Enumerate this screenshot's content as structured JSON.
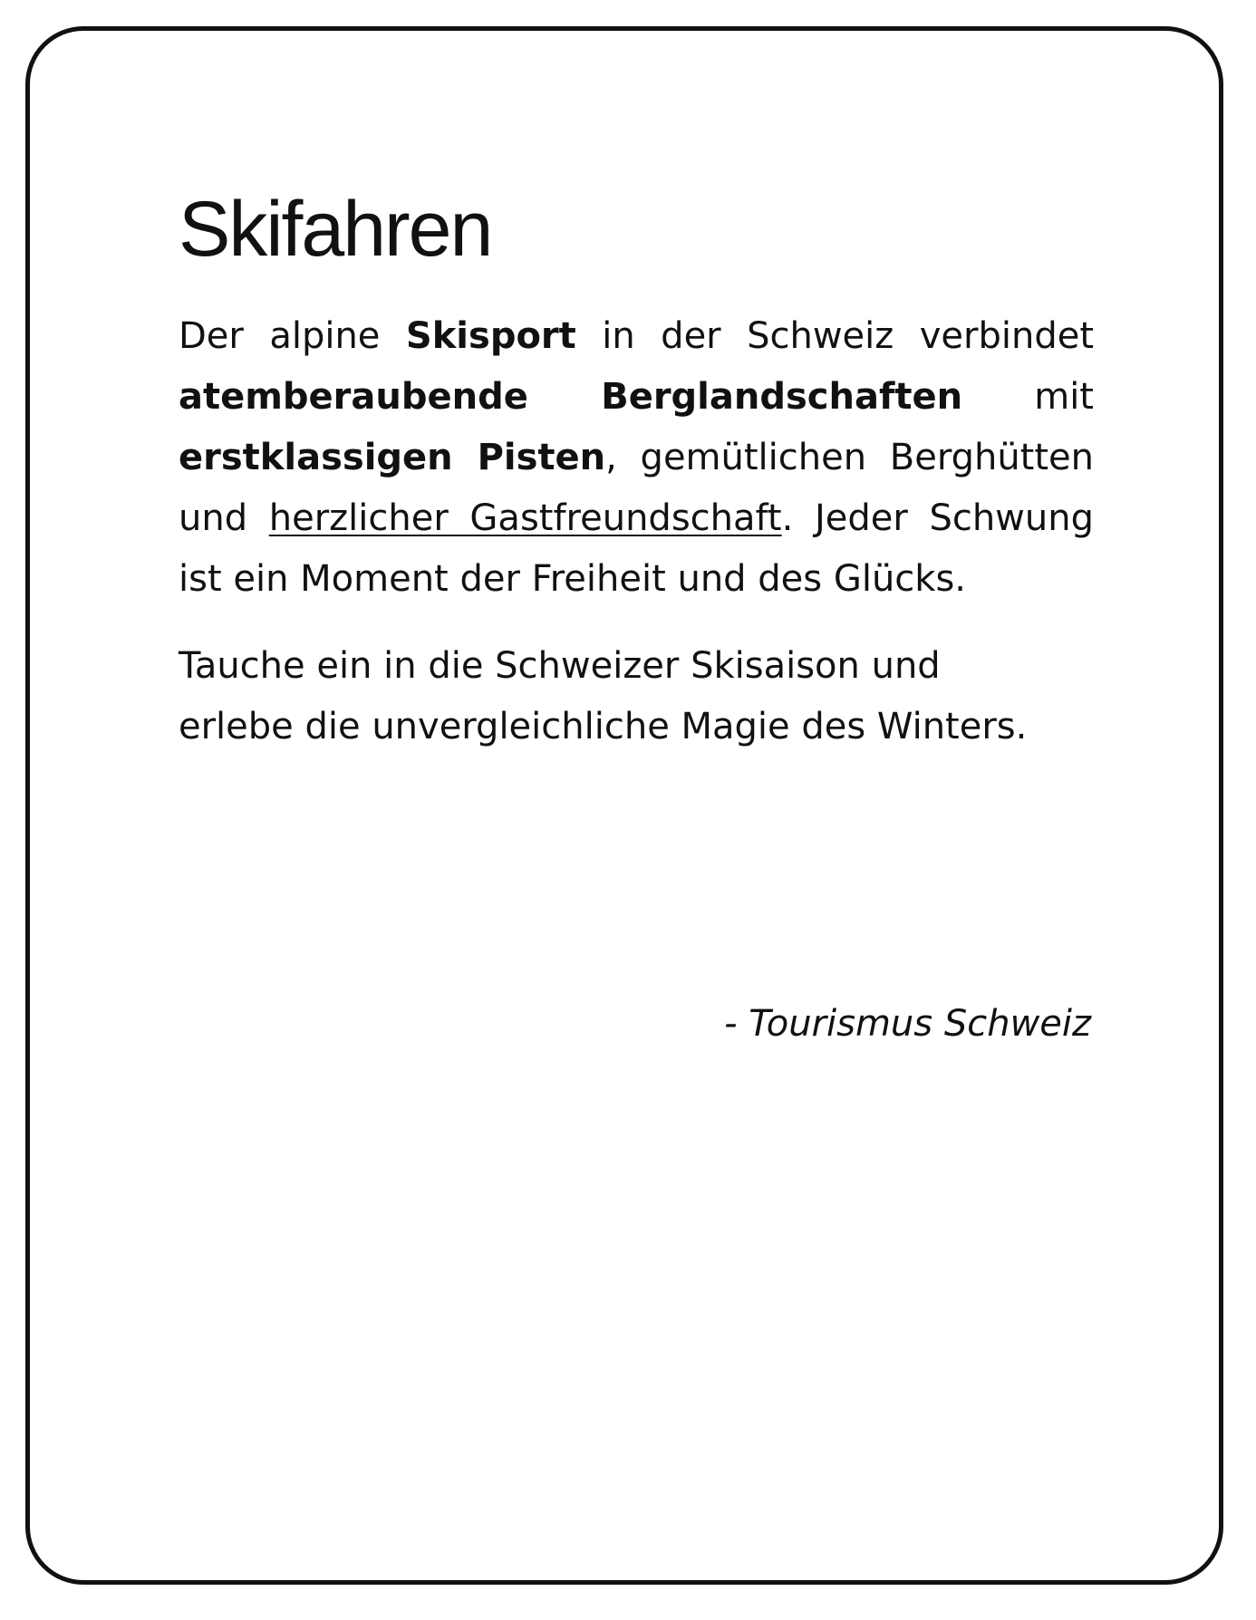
{
  "article": {
    "title": "Skifahren",
    "paragraph1": {
      "t1": "Der alpine ",
      "b1": "Skisport",
      "t2": " in der Schweiz verbindet ",
      "b2": "atemberaubende Berglandschaften",
      "t3": " mit ",
      "b3": "erstklassigen Pisten",
      "t4": ", gemütlichen Berghütten und ",
      "u1": "herzlicher Gastfreundschaft",
      "t5": ". Jeder Schwung ist ein Moment der Freiheit und des Glücks."
    },
    "paragraph2": "Tauche ein in die Schweizer Skisaison und erlebe die unvergleichliche Magie des Winters.",
    "attribution": "- Tourismus Schweiz"
  }
}
